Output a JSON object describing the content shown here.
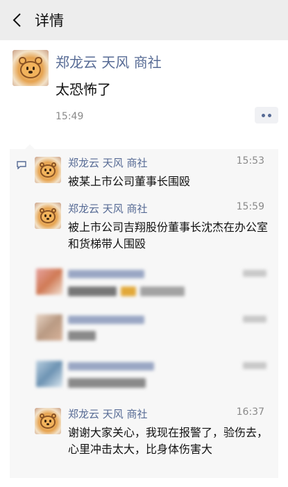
{
  "header": {
    "back_icon": "chevron-left-icon",
    "title": "详情"
  },
  "post": {
    "author": "郑龙云 天风 商社",
    "text": "太恐怖了",
    "time": "15:49",
    "more_icon": "more-dots-icon",
    "link_color": "#576b95"
  },
  "comments": [
    {
      "author": "郑龙云 天风 商社",
      "time": "15:53",
      "text": "被某上市公司董事长围殴"
    },
    {
      "author": "郑龙云 天风 商社",
      "time": "15:59",
      "text": "被上市公司吉翔股份董事长沈杰在办公室和货梯带人围殴"
    },
    {
      "author": "郑龙云 天风 商社",
      "time": "16:37",
      "text": "谢谢大家关心，我现在报警了，验伤去，心里冲击太大，比身体伤害大"
    }
  ]
}
